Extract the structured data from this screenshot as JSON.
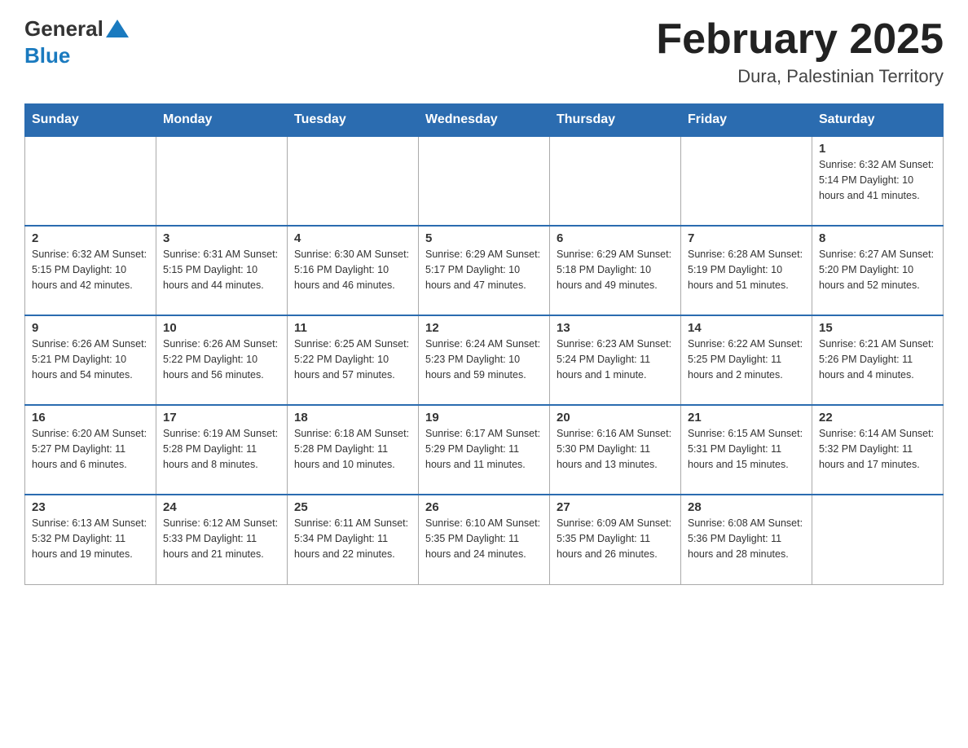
{
  "header": {
    "logo_general": "General",
    "logo_blue": "Blue",
    "month_title": "February 2025",
    "location": "Dura, Palestinian Territory"
  },
  "weekdays": [
    "Sunday",
    "Monday",
    "Tuesday",
    "Wednesday",
    "Thursday",
    "Friday",
    "Saturday"
  ],
  "weeks": [
    [
      {
        "day": "",
        "info": ""
      },
      {
        "day": "",
        "info": ""
      },
      {
        "day": "",
        "info": ""
      },
      {
        "day": "",
        "info": ""
      },
      {
        "day": "",
        "info": ""
      },
      {
        "day": "",
        "info": ""
      },
      {
        "day": "1",
        "info": "Sunrise: 6:32 AM\nSunset: 5:14 PM\nDaylight: 10 hours\nand 41 minutes."
      }
    ],
    [
      {
        "day": "2",
        "info": "Sunrise: 6:32 AM\nSunset: 5:15 PM\nDaylight: 10 hours\nand 42 minutes."
      },
      {
        "day": "3",
        "info": "Sunrise: 6:31 AM\nSunset: 5:15 PM\nDaylight: 10 hours\nand 44 minutes."
      },
      {
        "day": "4",
        "info": "Sunrise: 6:30 AM\nSunset: 5:16 PM\nDaylight: 10 hours\nand 46 minutes."
      },
      {
        "day": "5",
        "info": "Sunrise: 6:29 AM\nSunset: 5:17 PM\nDaylight: 10 hours\nand 47 minutes."
      },
      {
        "day": "6",
        "info": "Sunrise: 6:29 AM\nSunset: 5:18 PM\nDaylight: 10 hours\nand 49 minutes."
      },
      {
        "day": "7",
        "info": "Sunrise: 6:28 AM\nSunset: 5:19 PM\nDaylight: 10 hours\nand 51 minutes."
      },
      {
        "day": "8",
        "info": "Sunrise: 6:27 AM\nSunset: 5:20 PM\nDaylight: 10 hours\nand 52 minutes."
      }
    ],
    [
      {
        "day": "9",
        "info": "Sunrise: 6:26 AM\nSunset: 5:21 PM\nDaylight: 10 hours\nand 54 minutes."
      },
      {
        "day": "10",
        "info": "Sunrise: 6:26 AM\nSunset: 5:22 PM\nDaylight: 10 hours\nand 56 minutes."
      },
      {
        "day": "11",
        "info": "Sunrise: 6:25 AM\nSunset: 5:22 PM\nDaylight: 10 hours\nand 57 minutes."
      },
      {
        "day": "12",
        "info": "Sunrise: 6:24 AM\nSunset: 5:23 PM\nDaylight: 10 hours\nand 59 minutes."
      },
      {
        "day": "13",
        "info": "Sunrise: 6:23 AM\nSunset: 5:24 PM\nDaylight: 11 hours\nand 1 minute."
      },
      {
        "day": "14",
        "info": "Sunrise: 6:22 AM\nSunset: 5:25 PM\nDaylight: 11 hours\nand 2 minutes."
      },
      {
        "day": "15",
        "info": "Sunrise: 6:21 AM\nSunset: 5:26 PM\nDaylight: 11 hours\nand 4 minutes."
      }
    ],
    [
      {
        "day": "16",
        "info": "Sunrise: 6:20 AM\nSunset: 5:27 PM\nDaylight: 11 hours\nand 6 minutes."
      },
      {
        "day": "17",
        "info": "Sunrise: 6:19 AM\nSunset: 5:28 PM\nDaylight: 11 hours\nand 8 minutes."
      },
      {
        "day": "18",
        "info": "Sunrise: 6:18 AM\nSunset: 5:28 PM\nDaylight: 11 hours\nand 10 minutes."
      },
      {
        "day": "19",
        "info": "Sunrise: 6:17 AM\nSunset: 5:29 PM\nDaylight: 11 hours\nand 11 minutes."
      },
      {
        "day": "20",
        "info": "Sunrise: 6:16 AM\nSunset: 5:30 PM\nDaylight: 11 hours\nand 13 minutes."
      },
      {
        "day": "21",
        "info": "Sunrise: 6:15 AM\nSunset: 5:31 PM\nDaylight: 11 hours\nand 15 minutes."
      },
      {
        "day": "22",
        "info": "Sunrise: 6:14 AM\nSunset: 5:32 PM\nDaylight: 11 hours\nand 17 minutes."
      }
    ],
    [
      {
        "day": "23",
        "info": "Sunrise: 6:13 AM\nSunset: 5:32 PM\nDaylight: 11 hours\nand 19 minutes."
      },
      {
        "day": "24",
        "info": "Sunrise: 6:12 AM\nSunset: 5:33 PM\nDaylight: 11 hours\nand 21 minutes."
      },
      {
        "day": "25",
        "info": "Sunrise: 6:11 AM\nSunset: 5:34 PM\nDaylight: 11 hours\nand 22 minutes."
      },
      {
        "day": "26",
        "info": "Sunrise: 6:10 AM\nSunset: 5:35 PM\nDaylight: 11 hours\nand 24 minutes."
      },
      {
        "day": "27",
        "info": "Sunrise: 6:09 AM\nSunset: 5:35 PM\nDaylight: 11 hours\nand 26 minutes."
      },
      {
        "day": "28",
        "info": "Sunrise: 6:08 AM\nSunset: 5:36 PM\nDaylight: 11 hours\nand 28 minutes."
      },
      {
        "day": "",
        "info": ""
      }
    ]
  ]
}
